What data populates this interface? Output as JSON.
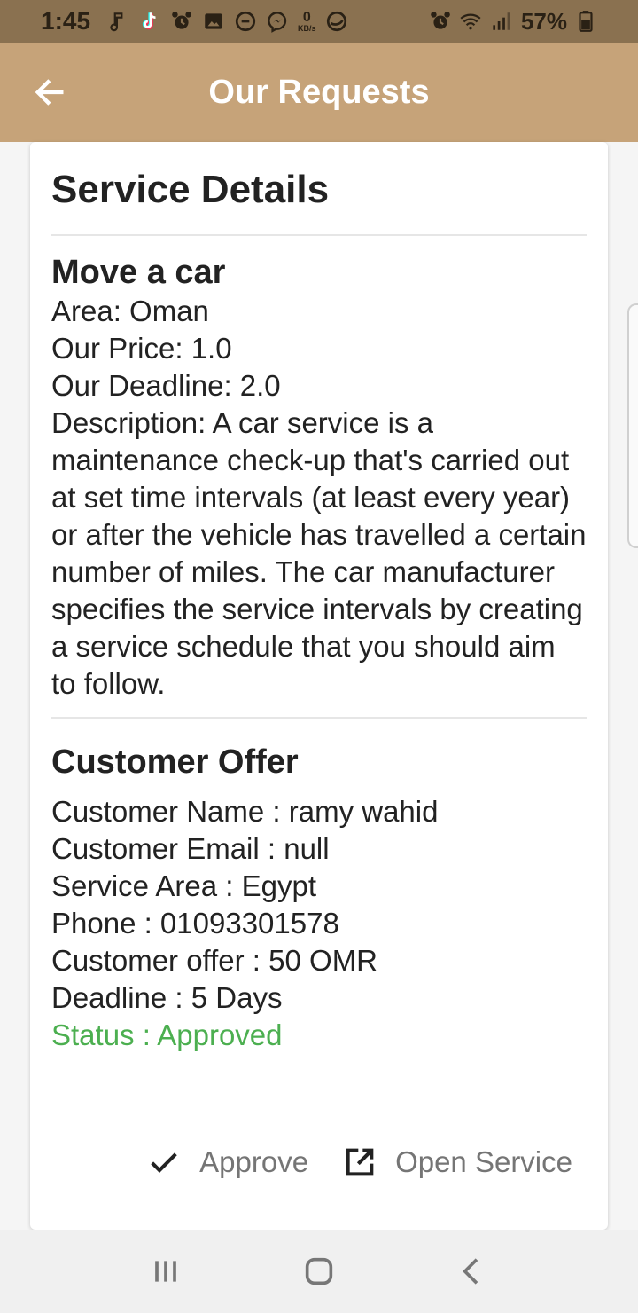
{
  "status_bar": {
    "time": "1:45",
    "data_rate_value": "0",
    "data_rate_unit": "KB/s",
    "battery": "57%",
    "icons": [
      "music-note-icon",
      "tiktok-icon",
      "alarm-icon",
      "image-icon",
      "circle-icon",
      "messenger-icon",
      "data-rate-icon",
      "app-icon",
      "alarm-icon",
      "wifi-icon",
      "signal-icon",
      "battery-icon"
    ]
  },
  "app_bar": {
    "title": "Our Requests",
    "back_icon": "back-arrow-icon",
    "background": "#c6a379"
  },
  "card": {
    "heading": "Service Details",
    "service": {
      "name": "Move a car",
      "area": "Area: Oman",
      "price": "Our Price: 1.0",
      "deadline": "Our Deadline: 2.0",
      "description": "Description: A car service is a maintenance check-up that's carried out at set time intervals (at least every year) or after the vehicle has travelled a certain number of miles. The car manufacturer specifies the service intervals by creating a service schedule that you should aim to follow."
    },
    "offer": {
      "title": "Customer Offer",
      "customer_name": "Customer Name : ramy wahid",
      "customer_email": "Customer Email : null",
      "service_area": "Service Area : Egypt",
      "phone": "Phone : 01093301578",
      "customer_offer": "Customer offer : 50 OMR",
      "deadline": "Deadline : 5 Days",
      "status": "Status : Approved",
      "status_color": "#4caf50"
    },
    "actions": {
      "approve_label": "Approve",
      "approve_icon": "check-icon",
      "open_service_label": "Open Service",
      "open_service_icon": "open-external-icon"
    }
  },
  "nav_bar": {
    "icons": [
      "recent-apps-icon",
      "home-icon",
      "back-icon"
    ]
  }
}
